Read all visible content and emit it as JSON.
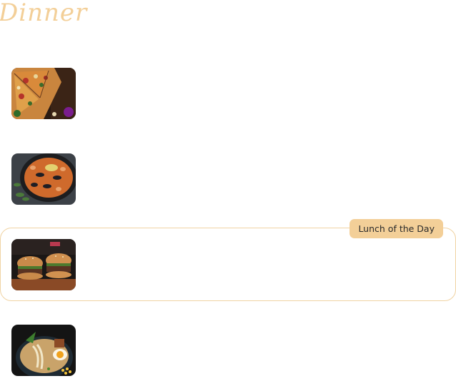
{
  "section": {
    "title": "Dinner"
  },
  "menu": {
    "items": [
      {
        "image_icon": "pizza-photo"
      },
      {
        "image_icon": "paella-photo"
      },
      {
        "image_icon": "burger-photo",
        "badge": "Lunch of the Day"
      },
      {
        "image_icon": "ramen-photo"
      }
    ]
  },
  "colors": {
    "accent": "#f3cf98",
    "featured_border": "#f0d3a3"
  }
}
